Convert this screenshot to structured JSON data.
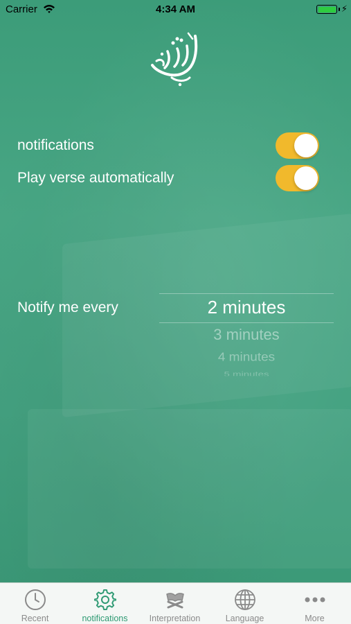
{
  "status_bar": {
    "carrier": "Carrier",
    "time": "4:34 AM"
  },
  "settings": {
    "notifications": {
      "label": "notifications",
      "enabled": true
    },
    "autoplay": {
      "label": "Play verse automatically",
      "enabled": true
    }
  },
  "interval": {
    "label": "Notify me every",
    "selected": "2 minutes",
    "options_below": [
      "3 minutes",
      "4 minutes",
      "5 minutes"
    ]
  },
  "tab_bar": {
    "tabs": [
      {
        "label": "Recent",
        "icon": "clock-icon",
        "active": false
      },
      {
        "label": "notifications",
        "icon": "gear-icon",
        "active": true
      },
      {
        "label": "Interpretation",
        "icon": "quran-stand-icon",
        "active": false
      },
      {
        "label": "Language",
        "icon": "globe-icon",
        "active": false
      },
      {
        "label": "More",
        "icon": "more-dots-icon",
        "active": false
      }
    ]
  },
  "colors": {
    "background": "#44a281",
    "toggle_on": "#f1b92c",
    "tab_active": "#2e9a73",
    "tab_inactive": "#8a8a8a"
  }
}
